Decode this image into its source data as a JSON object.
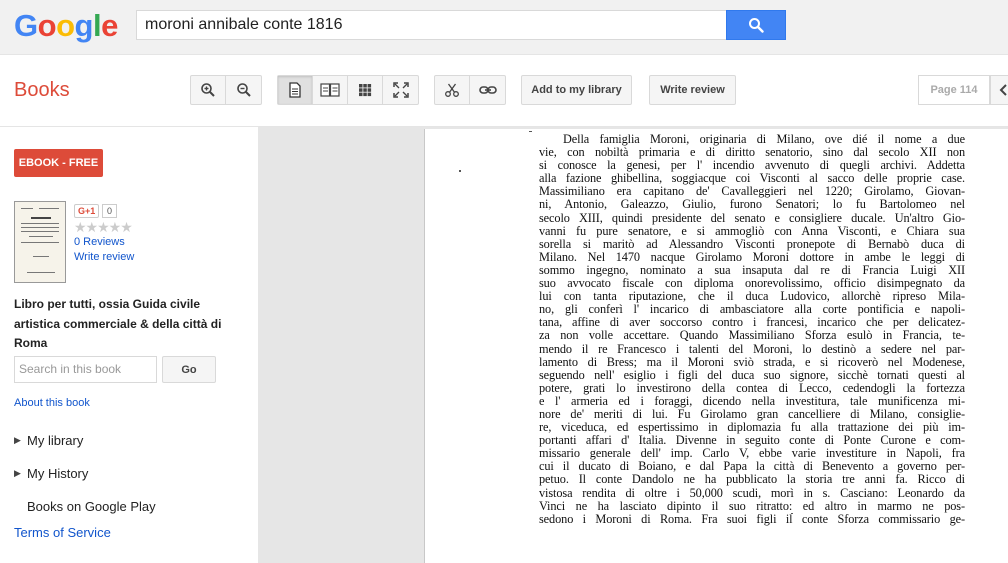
{
  "logo": {
    "letters": [
      "G",
      "o",
      "o",
      "g",
      "l",
      "e"
    ],
    "colors": [
      "#4285f4",
      "#ea4335",
      "#fbbc05",
      "#4285f4",
      "#34a853",
      "#ea4335"
    ]
  },
  "search": {
    "query": "moroni  annibale conte 1816",
    "button_icon": "search-icon"
  },
  "toolbar": {
    "section_title": "Books",
    "zoom_in_icon": "zoom-in-icon",
    "zoom_out_icon": "zoom-out-icon",
    "view_single_icon": "single-page-icon",
    "view_two_icon": "two-page-icon",
    "view_grid_icon": "thumbnail-grid-icon",
    "fullscreen_icon": "fullscreen-icon",
    "clip_icon": "scissors-icon",
    "link_icon": "link-icon",
    "add_library_label": "Add to my library",
    "write_review_label": "Write review",
    "page_indicator": "Page 114"
  },
  "sidebar": {
    "ebook_label": "EBOOK - FREE",
    "gplus_label": "G+1",
    "gplus_count": "0",
    "stars": "★★★★★",
    "reviews_label": "0 Reviews",
    "write_review_label": "Write review",
    "book_title": "Libro per tutti, ossia Guida civile artistica commerciale & della città di Roma",
    "search_placeholder": "Search in this book",
    "go_label": "Go",
    "about_label": "About this book",
    "nav": [
      {
        "label": "My library",
        "expandable": true
      },
      {
        "label": "My History",
        "expandable": true
      },
      {
        "label": "Books on Google Play",
        "expandable": false
      }
    ],
    "terms_label": "Terms of Service"
  },
  "page_text": [
    "Della famiglia Moroni, originaria di Milano, ove dié il nome a due",
    "vie, con nobiltà primaria e di diritto senatorio, sino dal secolo XII non",
    "si conosce la genesi, per l' incendio avvenuto di quegli archivi. Addetta",
    "alla fazione ghibellina, soggiacque coi Visconti al sacco delle proprie case.",
    "Massimiliano era capitano de' Cavalleggieri nel 1220; Girolamo, Giovan-",
    "ni, Antonio, Galeazzo, Giulio, furono Senatori; lo fu Bartolomeo nel",
    "secolo XIII, quindi presidente del senato e consigliere ducale. Un'altro Gio-",
    "vanni fu pure senatore, e si ammogliò con Anna Visconti, e Chiara sua",
    "sorella si maritò ad Alessandro Visconti pronepote di Bernabò duca di",
    "Milano. Nel 1470 nacque Girolamo Moroni dottore in ambe le leggi di",
    "sommo ingegno, nominato a sua insaputa dal re di Francia Luigi XII",
    "suo avvocato fiscale con diploma onorevolissimo, officio disimpegnato da",
    "lui con tanta riputazione, che il duca Ludovico, allorchè ripreso Mila-",
    "no, gli conferì l' incarico di ambasciatore alla corte pontificia e napoli-",
    "tana, affine di aver soccorso contro i francesi, incarico che per delicatez-",
    "za non volle accettare. Quando Massimiliano Sforza esulò in Francia, te-",
    "mendo il re Francesco i talenti del Moroni, lo destinò a sedere nel par-",
    "lamento di Bress; ma il Moroni sviò strada, e si ricoverò nel Modenese,",
    "seguendo nell' esiglio i figli del duca suo signore, sicchè tornati questi al",
    "potere, grati lo investirono della contea di Lecco, cedendogli la fortezza",
    "e l' armeria ed i foraggi, dicendo nella investitura, tale munificenza mi-",
    "nore de' meriti di lui. Fu Girolamo gran cancelliere di Milano, consiglie-",
    "re, viceduca, ed espertissimo in diplomazia fu alla trattazione dei più im-",
    "portanti affari d' Italia. Divenne in seguito conte di Ponte Curone e com-",
    "missario generale dell' imp. Carlo V, ebbe varie investiture in Napoli, fra",
    "cui il ducato di Boiano, e dal Papa la città di Benevento a governo per-",
    "petuo. Il conte Dandolo ne ha pubblicato la storia tre anni fa. Ricco di",
    "vistosa rendita di oltre i 50,000 scudi, morì in s. Casciano: Leonardo da",
    "Vinci ne ha lasciato dipinto il suo ritratto: ed altro in marmo ne pos-",
    "sedono i Moroni di Roma. Fra suoi figli il conte Sforza commissario ge-"
  ]
}
